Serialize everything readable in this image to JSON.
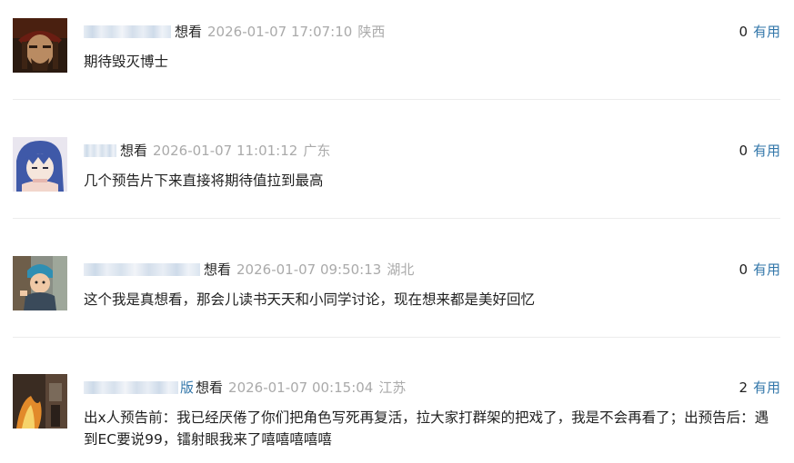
{
  "comments": [
    {
      "avatar": "avatar-pirate-portrait",
      "name_suffix": "",
      "rating": "想看",
      "time": "2026-01-07 17:07:10",
      "location": "陕西",
      "votes": "0",
      "useful_label": "有用",
      "content": "期待毁灭博士"
    },
    {
      "avatar": "avatar-anime-blue-hair",
      "name_suffix": "",
      "rating": "想看",
      "time": "2026-01-07 11:01:12",
      "location": "广东",
      "votes": "0",
      "useful_label": "有用",
      "content": "几个预告片下来直接将期待值拉到最高"
    },
    {
      "avatar": "avatar-child-photo",
      "name_suffix": "",
      "rating": "想看",
      "time": "2026-01-07 09:50:13",
      "location": "湖北",
      "votes": "0",
      "useful_label": "有用",
      "content": "这个我是真想看，那会儿读书天天和小同学讨论，现在想来都是美好回忆"
    },
    {
      "avatar": "avatar-fire-scene",
      "name_suffix": "版",
      "rating": "想看",
      "time": "2026-01-07 00:15:04",
      "location": "江苏",
      "votes": "2",
      "useful_label": "有用",
      "content": "出x人预告前：我已经厌倦了你们把角色写死再复活，拉大家打群架的把戏了，我是不会再看了；出预告后：遇到EC要说99，镭射眼我来了嘻嘻嘻嘻嘻"
    }
  ],
  "colors": {
    "link": "#3377aa",
    "meta_gray": "#aaaaaa",
    "text": "#222222",
    "divider": "#ececec"
  }
}
